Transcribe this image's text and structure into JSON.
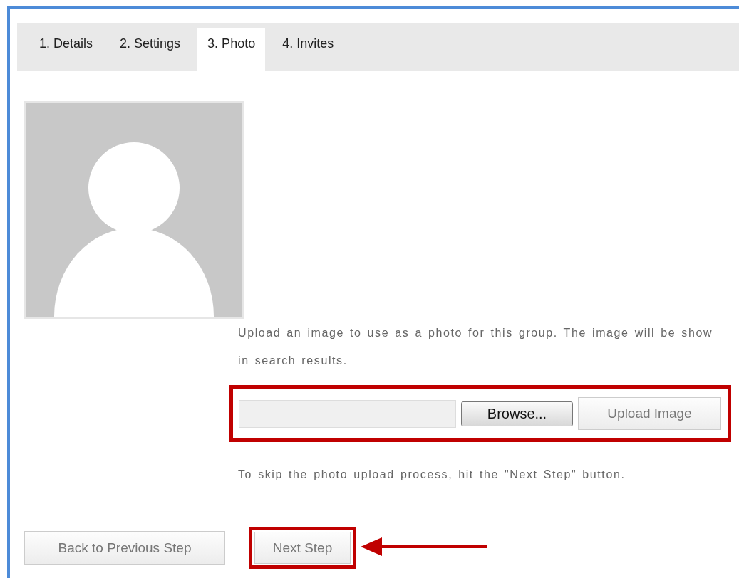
{
  "tabs": [
    {
      "label": "1. Details",
      "selected": false
    },
    {
      "label": "2. Settings",
      "selected": false
    },
    {
      "label": "3. Photo",
      "selected": true
    },
    {
      "label": "4. Invites",
      "selected": false
    }
  ],
  "description_lines": [
    "Upload an image to use as a photo for this group. The image will be show",
    "in search results."
  ],
  "upload": {
    "browse_button": "Browse...",
    "upload_button": "Upload Image"
  },
  "skip_hint": "To skip the photo upload process, hit the \"Next Step\" button.",
  "footer": {
    "back_button": "Back to Previous Step",
    "next_button": "Next Step"
  }
}
